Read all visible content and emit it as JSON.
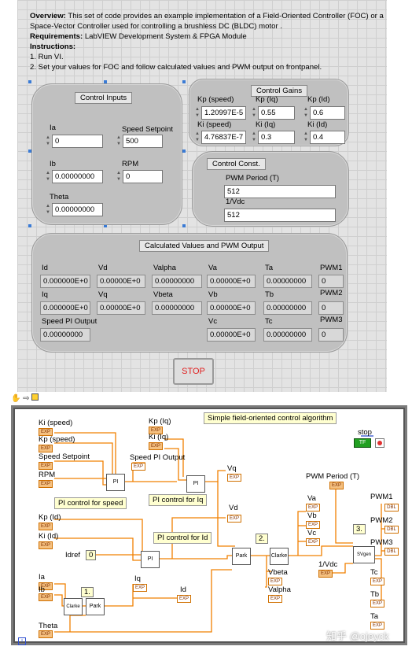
{
  "description": {
    "overview_label": "Overview:",
    "overview_text": " This set of code provides an example implementation of a Field-Oriented Controller (FOC) or a Space-Vector Controller used for controlling a brushless DC (BLDC) motor .",
    "requirements_label": "Requirements:",
    "requirements_text": " LabVIEW Development System &  FPGA Module",
    "instructions_label": "Instructions:",
    "step1": "1. Run VI.",
    "step2": "2. Set your values for FOC and follow calculated values and PWM output on frontpanel."
  },
  "control_inputs": {
    "title": "Control Inputs",
    "ia_label": "Ia",
    "ia_value": "0",
    "speed_setpoint_label": "Speed Setpoint",
    "speed_setpoint_value": "500",
    "ib_label": "Ib",
    "ib_value": "0.00000000",
    "rpm_label": "RPM",
    "rpm_value": "0",
    "theta_label": "Theta",
    "theta_value": "0.00000000"
  },
  "control_gains": {
    "title": "Control Gains",
    "kp_speed_label": "Kp (speed)",
    "kp_speed_value": "1.20997E-5",
    "kp_iq_label": "Kp (Iq)",
    "kp_iq_value": "0.55",
    "kp_id_label": "Kp (Id)",
    "kp_id_value": "0.6",
    "ki_speed_label": "Ki (speed)",
    "ki_speed_value": "4.76837E-7",
    "ki_iq_label": "Ki (Iq)",
    "ki_iq_value": "0.3",
    "ki_id_label": "Ki (Id)",
    "ki_id_value": "0.4"
  },
  "control_const": {
    "title": "Control Const.",
    "pwm_period_label": "PWM  Period (T)",
    "pwm_period_value": "512",
    "vdc_label": "1/Vdc",
    "vdc_value": "512"
  },
  "calculated": {
    "title": "Calculated Values and PWM Output",
    "id_label": "Id",
    "id_value": "0.000000E+0",
    "vd_label": "Vd",
    "vd_value": "0.00000E+0",
    "valpha_label": "Valpha",
    "valpha_value": "0.00000000",
    "va_label": "Va",
    "va_value": "0.00000E+0",
    "ta_label": "Ta",
    "ta_value": "0.00000000",
    "pwm1_label": "PWM1",
    "pwm1_value": "0",
    "iq_label": "Iq",
    "iq_value": "0.000000E+0",
    "vq_label": "Vq",
    "vq_value": "0.00000E+0",
    "vbeta_label": "Vbeta",
    "vbeta_value": "0.00000000",
    "vb_label": "Vb",
    "vb_value": "0.00000E+0",
    "tb_label": "Tb",
    "tb_value": "0.00000000",
    "pwm2_label": "PWM2",
    "pwm2_value": "0",
    "speed_pi_label": "Speed PI Output",
    "speed_pi_value": "0.00000000",
    "vc_label": "Vc",
    "vc_value": "0.00000E+0",
    "tc_label": "Tc",
    "tc_value": "0.00000000",
    "pwm3_label": "PWM3",
    "pwm3_value": "0"
  },
  "stop_button": "STOP",
  "block_diagram": {
    "title_note": "Simple field-oriented control algorithm",
    "stop_label": "stop",
    "tf_label": "TF",
    "ki_speed": "Ki (speed)",
    "kp_speed": "Kp (speed)",
    "speed_setpoint": "Speed Setpoint",
    "rpm": "RPM",
    "kp_iq": "Kp (Iq)",
    "ki_iq": "Ki (Iq)",
    "speed_pi_output": "Speed PI Output",
    "vq": "Vq",
    "pi_speed_note": "PI control for speed",
    "pi_iq_note": "PI control for Iq",
    "kp_id": "Kp (Id)",
    "ki_id": "Ki (Id)",
    "pi_id_note": "PI control for Id",
    "idref": "Idref",
    "idref_value": "0",
    "vd": "Vd",
    "pwm_period": "PWM  Period (T)",
    "va": "Va",
    "vb": "Vb",
    "vc": "Vc",
    "step2": "2.",
    "step3": "3.",
    "step1": "1.",
    "vbeta": "Vbeta",
    "valpha": "Valpha",
    "vdc": "1/Vdc",
    "pwm1": "PWM1",
    "pwm2": "PWM2",
    "pwm3": "PWM3",
    "tc": "Tc",
    "tb": "Tb",
    "ta": "Ta",
    "ia": "Ia",
    "ib": "Ib",
    "iq": "Iq",
    "id": "Id",
    "theta": "Theta",
    "pi_block": "PI",
    "park_block": "Park",
    "clarke_block": "Clarke",
    "svgen_block": "SVgen",
    "exp_tag": "EXP",
    "dbl_tag": "DBL",
    "watermark": "知乎 @ojeyck"
  }
}
